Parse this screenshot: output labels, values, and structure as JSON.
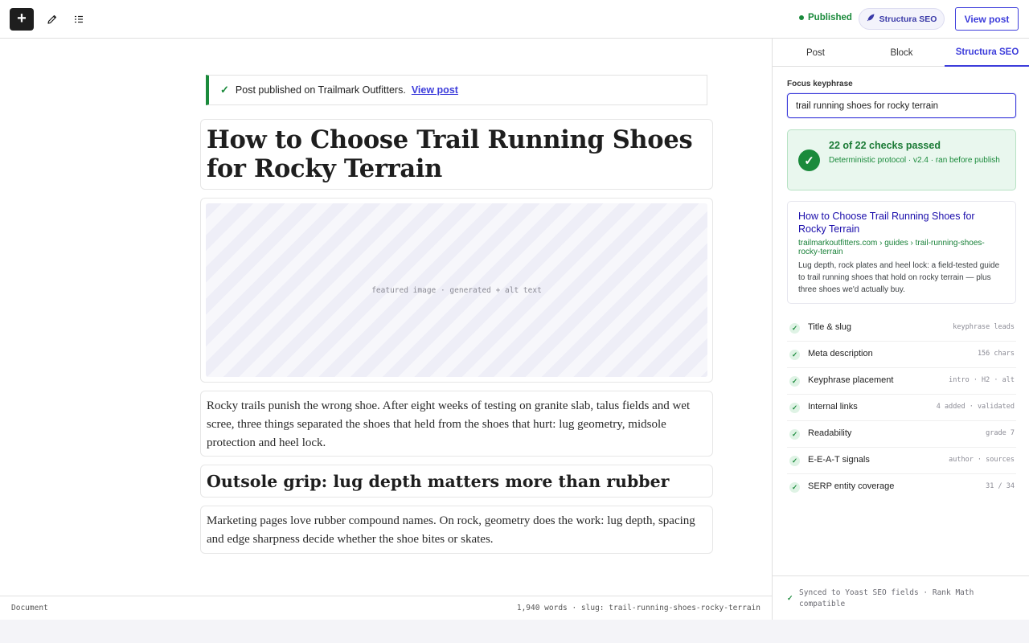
{
  "toolbar": {
    "add_label": "+",
    "published_label": "Published",
    "seo_label": "Structura SEO",
    "view_post_label": "View post"
  },
  "notice": {
    "message": "Post published on Trailmark Outfitters.",
    "link": "View post"
  },
  "post": {
    "title": "How to Choose Trail Running Shoes for Rocky Terrain",
    "image_placeholder": "featured image · generated + alt text",
    "paragraph1": "Rocky trails punish the wrong shoe. After eight weeks of testing on granite slab, talus fields and wet scree, three things separated the shoes that held from the shoes that hurt: lug geometry, midsole protection and heel lock.",
    "heading2": "Outsole grip: lug depth matters more than rubber",
    "paragraph2": "Marketing pages love rubber compound names. On rock, geometry does the work: lug depth, spacing and edge sharpness decide whether the shoe bites or skates."
  },
  "footer": {
    "left": "Document",
    "right": "1,940 words · slug: trail-running-shoes-rocky-terrain"
  },
  "sidebar": {
    "tabs": [
      "Post",
      "Block",
      "Structura SEO"
    ],
    "active_tab": "Structura SEO",
    "keyphrase_label": "Focus keyphrase",
    "keyphrase_value": "trail running shoes for rocky terrain",
    "checks_title": "22 of 22 checks passed",
    "checks_sub": "Deterministic protocol · v2.4 · ran before publish",
    "serp": {
      "title": "How to Choose Trail Running Shoes for Rocky Terrain",
      "url": "trailmarkoutfitters.com › guides › trail-running-shoes-rocky-terrain",
      "description": "Lug depth, rock plates and heel lock: a field-tested guide to trail running shoes that hold on rocky terrain — plus three shoes we'd actually buy."
    },
    "checks": [
      {
        "label": "Title & slug",
        "detail": "keyphrase leads"
      },
      {
        "label": "Meta description",
        "detail": "156 chars"
      },
      {
        "label": "Keyphrase placement",
        "detail": "intro · H2 · alt"
      },
      {
        "label": "Internal links",
        "detail": "4 added · validated"
      },
      {
        "label": "Readability",
        "detail": "grade 7"
      },
      {
        "label": "E-E-A-T signals",
        "detail": "author · sources"
      },
      {
        "label": "SERP entity coverage",
        "detail": "31 / 34"
      }
    ],
    "sync_text": "Synced to Yoast SEO fields · Rank Math compatible"
  },
  "colors": {
    "accent": "#3d3ddb",
    "success": "#1a8a3b"
  }
}
